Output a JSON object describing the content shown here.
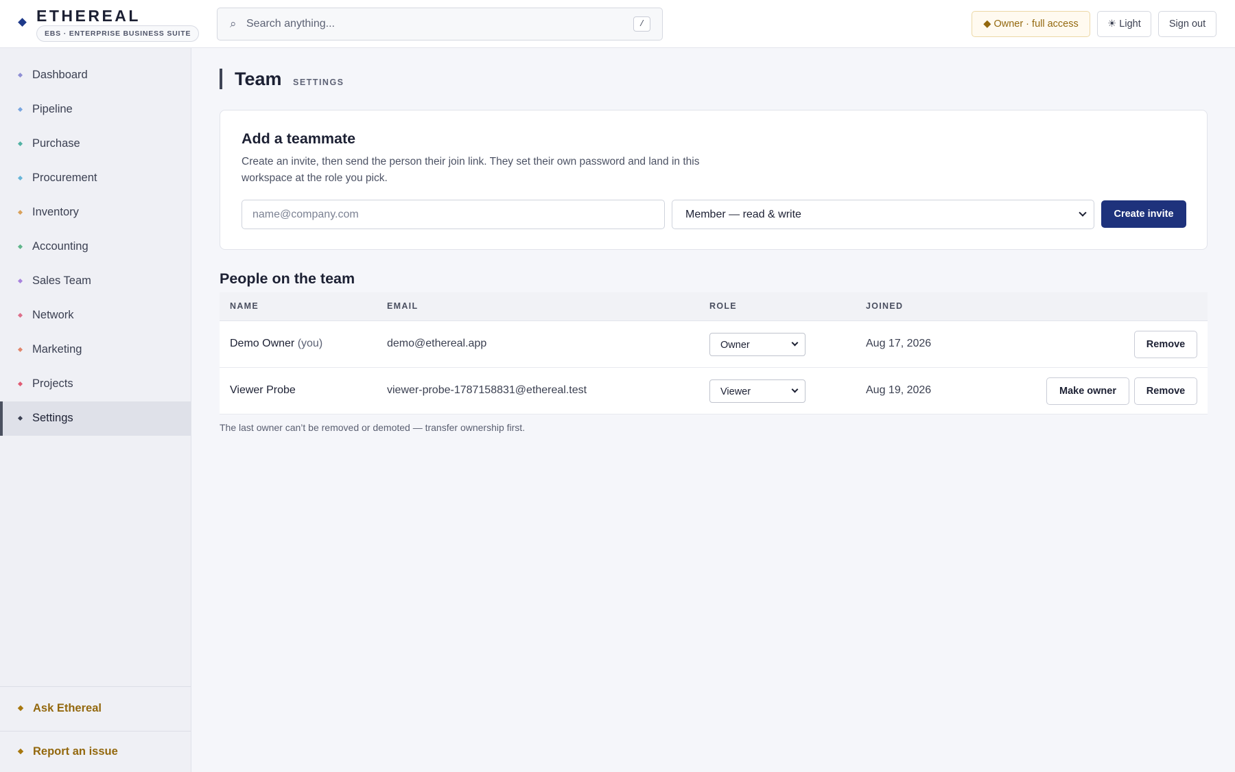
{
  "header": {
    "brand_name": "ETHEREAL",
    "brand_sub": "EBS · ENTERPRISE BUSINESS SUITE",
    "search_placeholder": "Search anything...",
    "search_shortcut": "/",
    "owner_badge": "◆ Owner · full access",
    "theme_button": "☀ Light",
    "signout_button": "Sign out"
  },
  "sidebar": {
    "items": [
      {
        "label": "Dashboard",
        "color": "#8f8fd4"
      },
      {
        "label": "Pipeline",
        "color": "#79a6e0"
      },
      {
        "label": "Purchase",
        "color": "#52b2a4"
      },
      {
        "label": "Procurement",
        "color": "#67b5d8"
      },
      {
        "label": "Inventory",
        "color": "#d9a15b"
      },
      {
        "label": "Accounting",
        "color": "#5fb58a"
      },
      {
        "label": "Sales Team",
        "color": "#a883dd"
      },
      {
        "label": "Network",
        "color": "#dd6f8a"
      },
      {
        "label": "Marketing",
        "color": "#e1866b"
      },
      {
        "label": "Projects",
        "color": "#e05c74"
      },
      {
        "label": "Settings",
        "color": "#3b4052"
      }
    ],
    "active": "Settings",
    "footer": {
      "ask": "Ask Ethereal",
      "report": "Report an issue"
    }
  },
  "page": {
    "title": "Team",
    "subtitle": "SETTINGS"
  },
  "invite": {
    "title": "Add a teammate",
    "description": "Create an invite, then send the person their join link. They set their own password and land in this workspace at the role you pick.",
    "email_placeholder": "name@company.com",
    "role_value": "Member — read & write",
    "create_button": "Create invite"
  },
  "team": {
    "title": "People on the team",
    "columns": [
      "NAME",
      "EMAIL",
      "ROLE",
      "JOINED"
    ],
    "rows": [
      {
        "name": "Demo Owner",
        "you": "(you)",
        "email": "demo@ethereal.app",
        "role": "Owner",
        "joined": "Aug 17, 2026",
        "remove": "Remove"
      },
      {
        "name": "Viewer Probe",
        "you": "",
        "email": "viewer-probe-1787158831@ethereal.test",
        "role": "Viewer",
        "joined": "Aug 19, 2026",
        "make_owner": "Make owner",
        "remove": "Remove"
      }
    ],
    "footnote": "The last owner can’t be removed or demoted — transfer ownership first."
  },
  "colors": {
    "primary": "#1e327c",
    "accent_gold": "#93680e",
    "brand_mark": "#1e3a8a"
  }
}
